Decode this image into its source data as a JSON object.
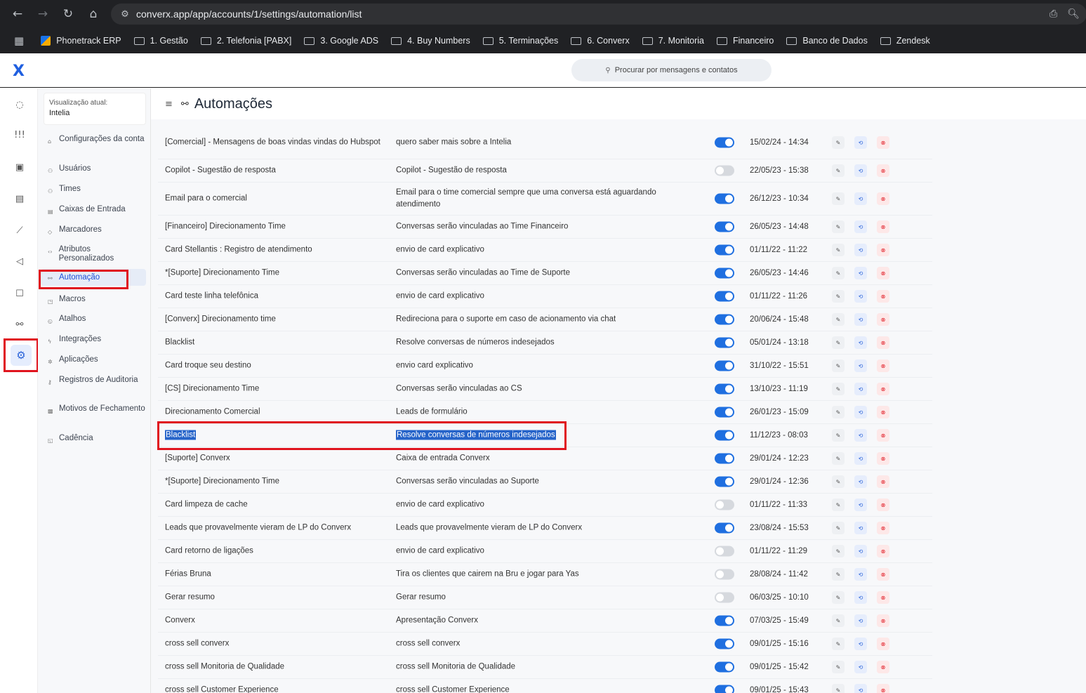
{
  "browser": {
    "url": "converx.app/app/accounts/1/settings/automation/list",
    "bookmarks": [
      {
        "label": "Phonetrack ERP",
        "type": "site"
      },
      {
        "label": "1. Gestão",
        "type": "folder"
      },
      {
        "label": "2. Telefonia [PABX]",
        "type": "folder"
      },
      {
        "label": "3. Google ADS",
        "type": "folder"
      },
      {
        "label": "4. Buy Numbers",
        "type": "folder"
      },
      {
        "label": "5. Terminações",
        "type": "folder"
      },
      {
        "label": "6. Converx",
        "type": "folder"
      },
      {
        "label": "7. Monitoria",
        "type": "folder"
      },
      {
        "label": "Financeiro",
        "type": "folder"
      },
      {
        "label": "Banco de Dados",
        "type": "folder"
      },
      {
        "label": "Zendesk",
        "type": "folder"
      }
    ]
  },
  "header": {
    "brand": "X",
    "search_placeholder": "Procurar por mensagens e contatos"
  },
  "sidebar": {
    "current_view_label": "Visualização atual:",
    "current_view_value": "Intelia",
    "items": [
      {
        "label": "Configurações da conta",
        "icon": "lock-icon"
      },
      {
        "label": "Usuários",
        "icon": "users-icon"
      },
      {
        "label": "Times",
        "icon": "team-icon"
      },
      {
        "label": "Caixas de Entrada",
        "icon": "inbox-icon"
      },
      {
        "label": "Marcadores",
        "icon": "tag-icon"
      },
      {
        "label": "Atributos Personalizados",
        "icon": "code-icon"
      },
      {
        "label": "Automação",
        "icon": "automation-icon",
        "active": true
      },
      {
        "label": "Macros",
        "icon": "macro-icon"
      },
      {
        "label": "Atalhos",
        "icon": "shortcut-icon"
      },
      {
        "label": "Integrações",
        "icon": "plug-icon"
      },
      {
        "label": "Aplicações",
        "icon": "apps-icon"
      },
      {
        "label": "Registros de Auditoria",
        "icon": "key-icon"
      },
      {
        "label": "Motivos de Fechamento",
        "icon": "close-reason-icon"
      },
      {
        "label": "Cadência",
        "icon": "cadence-icon"
      }
    ]
  },
  "page": {
    "title": "Automações"
  },
  "automations": [
    {
      "name": "[Comercial] - Mensagens de boas vindas vindas do Hubspot",
      "description": "quero saber mais sobre a Intelia",
      "active": true,
      "date": "15/02/24 - 14:34"
    },
    {
      "name": "Copilot - Sugestão de resposta",
      "description": "Copilot - Sugestão de resposta",
      "active": false,
      "date": "22/05/23 - 15:38"
    },
    {
      "name": "Email para o comercial",
      "description": "Email para o time comercial sempre que uma conversa está aguardando atendimento",
      "active": true,
      "date": "26/12/23 - 10:34"
    },
    {
      "name": "[Financeiro] Direcionamento Time",
      "description": "Conversas serão vinculadas ao Time Financeiro",
      "active": true,
      "date": "26/05/23 - 14:48"
    },
    {
      "name": "Card Stellantis : Registro de atendimento",
      "description": "envio de card explicativo",
      "active": true,
      "date": "01/11/22 - 11:22"
    },
    {
      "name": "*[Suporte] Direcionamento Time",
      "description": "Conversas serão vinculadas ao Time de Suporte",
      "active": true,
      "date": "26/05/23 - 14:46"
    },
    {
      "name": "Card teste linha telefônica",
      "description": "envio de card explicativo",
      "active": true,
      "date": "01/11/22 - 11:26"
    },
    {
      "name": "[Converx] Direcionamento time",
      "description": "Redireciona para o suporte em caso de acionamento via chat",
      "active": true,
      "date": "20/06/24 - 15:48"
    },
    {
      "name": "Blacklist",
      "description": "Resolve conversas de números indesejados",
      "active": true,
      "date": "05/01/24 - 13:18"
    },
    {
      "name": "Card troque seu destino",
      "description": "envio card explicativo",
      "active": true,
      "date": "31/10/22 - 15:51"
    },
    {
      "name": "[CS] Direcionamento Time",
      "description": "Conversas serão vinculadas ao CS",
      "active": true,
      "date": "13/10/23 - 11:19"
    },
    {
      "name": "Direcionamento Comercial",
      "description": "Leads de formulário",
      "active": true,
      "date": "26/01/23 - 15:09"
    },
    {
      "name": "Blacklist",
      "description": "Resolve conversas de números indesejados",
      "active": true,
      "date": "11/12/23 - 08:03",
      "highlighted": true
    },
    {
      "name": "[Suporte] Converx",
      "description": "Caixa de entrada Converx",
      "active": true,
      "date": "29/01/24 - 12:23"
    },
    {
      "name": "*[Suporte] Direcionamento Time",
      "description": "Conversas serão vinculadas ao Suporte",
      "active": true,
      "date": "29/01/24 - 12:36"
    },
    {
      "name": "Card limpeza de cache",
      "description": "envio de card explicativo",
      "active": false,
      "date": "01/11/22 - 11:33"
    },
    {
      "name": "Leads que provavelmente vieram de LP do Converx",
      "description": "Leads que provavelmente vieram de LP do Converx",
      "active": true,
      "date": "23/08/24 - 15:53"
    },
    {
      "name": "Card retorno de ligações",
      "description": "envio de card explicativo",
      "active": false,
      "date": "01/11/22 - 11:29"
    },
    {
      "name": "Férias Bruna",
      "description": "Tira os clientes que cairem na Bru e jogar para Yas",
      "active": false,
      "date": "28/08/24 - 11:42"
    },
    {
      "name": "Gerar resumo",
      "description": "Gerar resumo",
      "active": false,
      "date": "06/03/25 - 10:10"
    },
    {
      "name": "Converx",
      "description": "Apresentação Converx",
      "active": true,
      "date": "07/03/25 - 15:49"
    },
    {
      "name": "cross sell converx",
      "description": "cross sell converx",
      "active": true,
      "date": "09/01/25 - 15:16"
    },
    {
      "name": "cross sell Monitoria de Qualidade",
      "description": "cross sell Monitoria de Qualidade",
      "active": true,
      "date": "09/01/25 - 15:42"
    },
    {
      "name": "cross sell Customer Experience",
      "description": "cross sell Customer Experience",
      "active": true,
      "date": "09/01/25 - 15:43"
    }
  ],
  "colors": {
    "accent": "#1f6fe0",
    "highlight_frame": "#e0141e",
    "selection": "#2563c9"
  }
}
